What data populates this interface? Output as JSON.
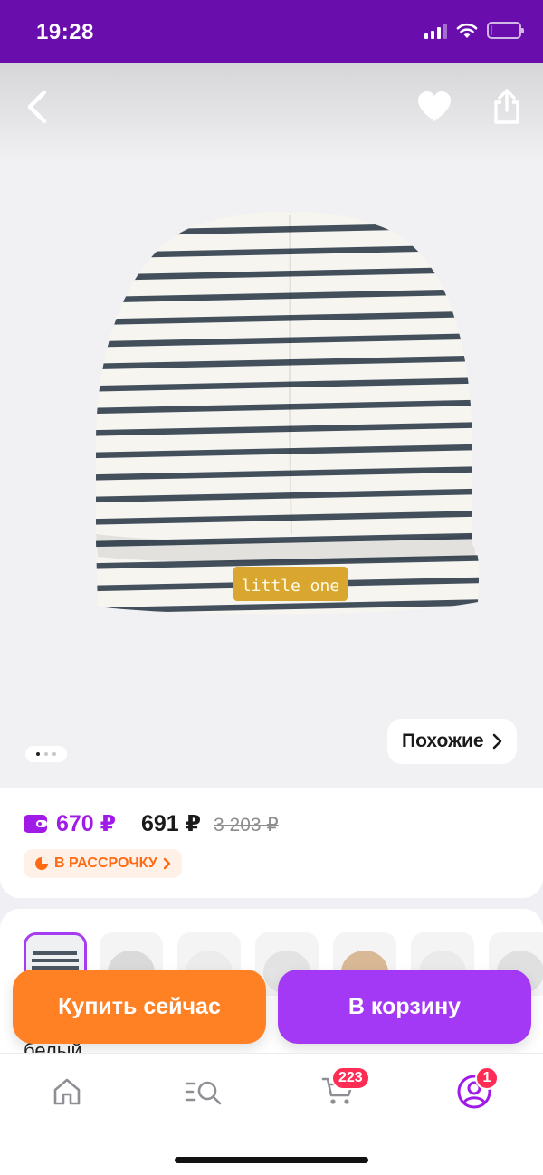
{
  "status_bar": {
    "time": "19:28",
    "icons": [
      "signal-icon",
      "wifi-icon",
      "battery-icon"
    ],
    "background": "#6a0dad"
  },
  "product": {
    "image_alt": "Шапка в полоску little one",
    "patch_text": "little one",
    "gallery": {
      "total": 3,
      "active": 1
    },
    "similar_label": "Похожие"
  },
  "pricing": {
    "wallet_price": "670 ₽",
    "price": "691 ₽",
    "old_price": "3 203 ₽",
    "installment_label": "В РАССРОЧКУ",
    "wallet_color": "#a11be8",
    "installment_color": "#ff6a13"
  },
  "variants": {
    "count": 7,
    "selected_index": 0,
    "color_label": "белый"
  },
  "actions": {
    "buy_now": "Купить сейчас",
    "add_to_cart": "В корзину",
    "buy_color": "#ff8124",
    "cart_color": "#a339f5"
  },
  "tab_bar": {
    "items": [
      {
        "name": "home",
        "icon": "home-icon"
      },
      {
        "name": "catalog",
        "icon": "catalog-search-icon"
      },
      {
        "name": "cart",
        "icon": "cart-icon",
        "badge": "223"
      },
      {
        "name": "profile",
        "icon": "profile-icon",
        "badge": "1"
      }
    ]
  }
}
